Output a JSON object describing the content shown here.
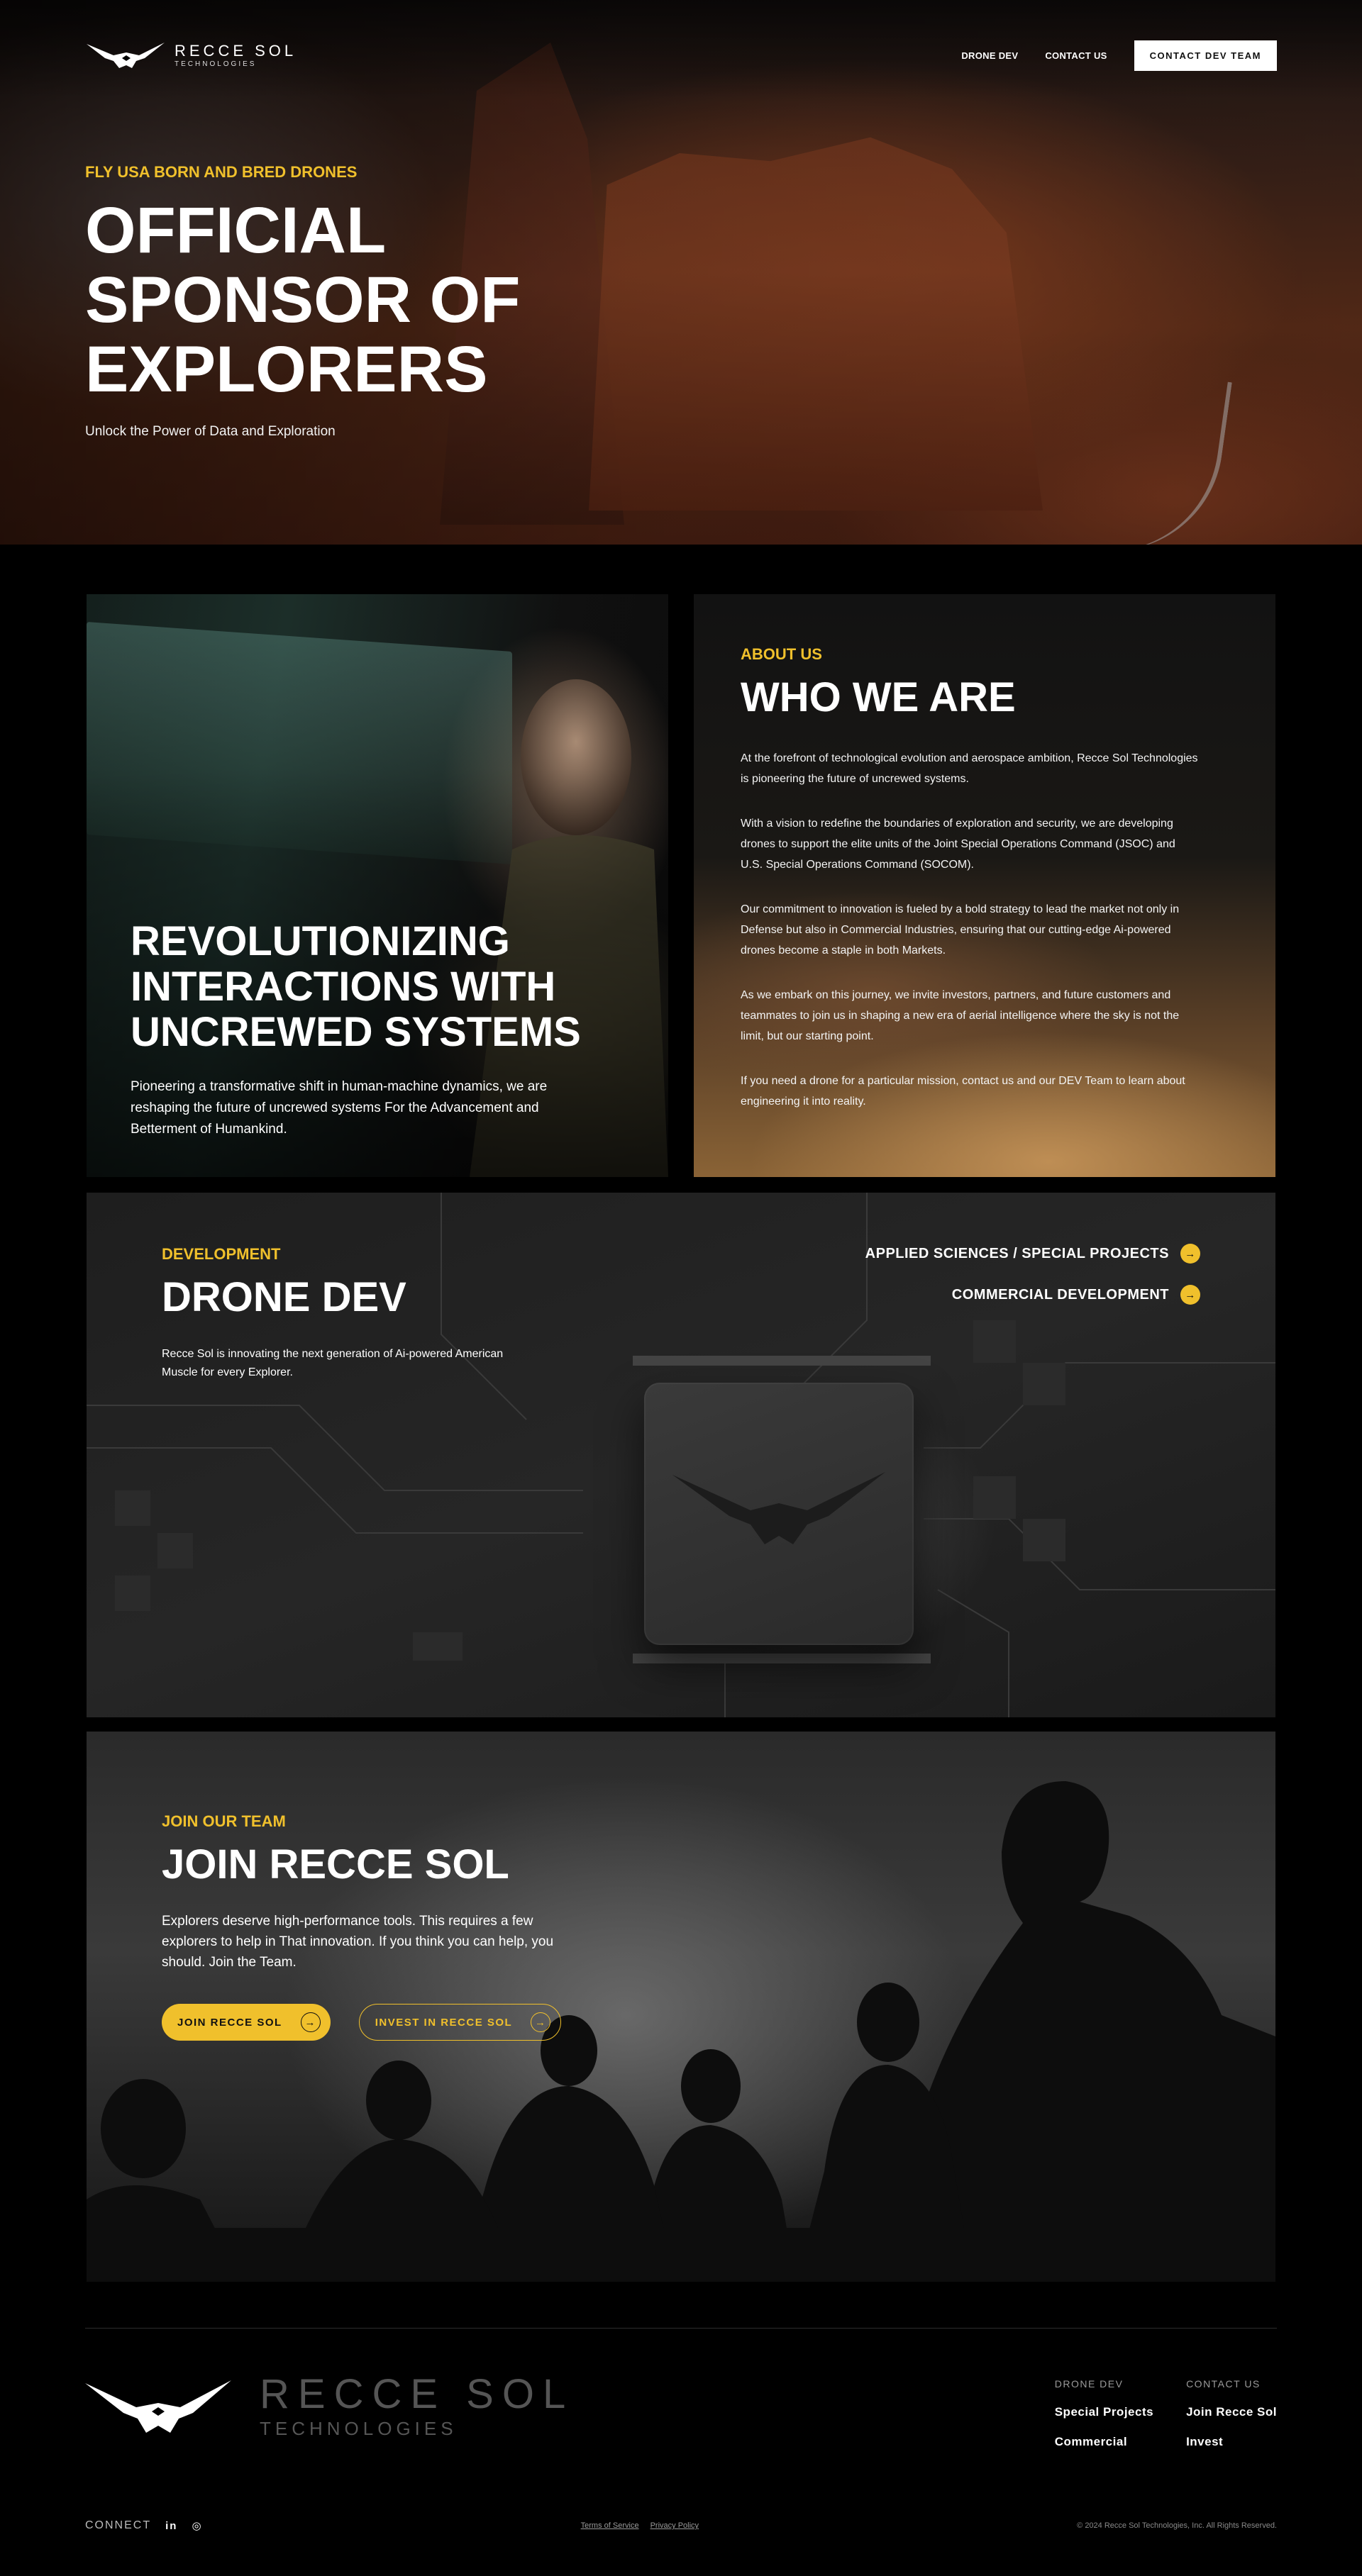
{
  "nav": {
    "logo_line1": "RECCE  SOL",
    "logo_line2": "TECHNOLOGIES",
    "links": [
      "DRONE DEV",
      "CONTACT US"
    ],
    "cta": "CONTACT DEV TEAM"
  },
  "hero": {
    "eyebrow": "FLY USA BORN AND BRED DRONES",
    "title": "OFFICIAL SPONSOR OF EXPLORERS",
    "subtitle": "Unlock the Power of Data and Exploration"
  },
  "revolution": {
    "title": "REVOLUTIONIZING INTERACTIONS WITH UNCREWED SYSTEMS",
    "text": "Pioneering a transformative shift in human-machine dynamics, we are reshaping the future of uncrewed systems For the Advancement and Betterment of Humankind."
  },
  "about": {
    "eyebrow": "ABOUT US",
    "title": "WHO WE ARE",
    "paragraphs": [
      "At the forefront of technological evolution and aerospace ambition, Recce Sol Technologies is pioneering the future of uncrewed systems.",
      "With a vision to redefine the boundaries of exploration and security, we are developing drones to support the elite units of the Joint Special Operations Command (JSOC) and U.S. Special Operations Command (SOCOM).",
      "Our commitment to innovation is fueled by a bold strategy to lead the market not only in Defense but also in Commercial Industries, ensuring that our cutting-edge Ai-powered drones become a staple in both Markets.",
      "As we embark on this journey, we invite investors, partners, and future customers and teammates to join us in shaping a new era of aerial intelligence where the sky is not the limit, but our starting point.",
      "If you need a drone for a particular mission, contact us and our DEV Team to learn about engineering it into reality."
    ]
  },
  "dev": {
    "eyebrow": "DEVELOPMENT",
    "title": "DRONE DEV",
    "text": "Recce Sol is innovating the next generation of Ai-powered American Muscle for every Explorer.",
    "links": [
      "APPLIED SCIENCES / SPECIAL PROJECTS",
      "COMMERCIAL DEVELOPMENT"
    ],
    "arrow_icon": "arrow-right-icon"
  },
  "join": {
    "eyebrow": "JOIN OUR TEAM",
    "title": "JOIN RECCE SOL",
    "text": "Explorers deserve high-performance tools. This requires a few explorers to help in That innovation. If you think you can help, you should. Join the Team.",
    "primary_button": "JOIN RECCE SOL",
    "secondary_button": "INVEST IN RECCE SOL"
  },
  "footer": {
    "logo_line1": "RECCE  SOL",
    "logo_line2": "TECHNOLOGIES",
    "col1_head": "DRONE DEV",
    "col1_links": [
      "Special Projects",
      "Commercial"
    ],
    "col2_head": "CONTACT US",
    "col2_links": [
      "Join Recce Sol",
      "Invest"
    ],
    "connect": "CONNECT",
    "social_icons": [
      "linkedin-icon",
      "instagram-icon"
    ],
    "linkedin_glyph": "in",
    "instagram_glyph": "◎",
    "legal_terms": "Terms of Service",
    "legal_privacy": "Privacy Policy",
    "copyright": "© 2024 Recce Sol Technologies, Inc. All Rights Reserved."
  },
  "colors": {
    "accent": "#f0c02c",
    "background": "#000000",
    "nav_cta_bg": "#ffffff"
  }
}
